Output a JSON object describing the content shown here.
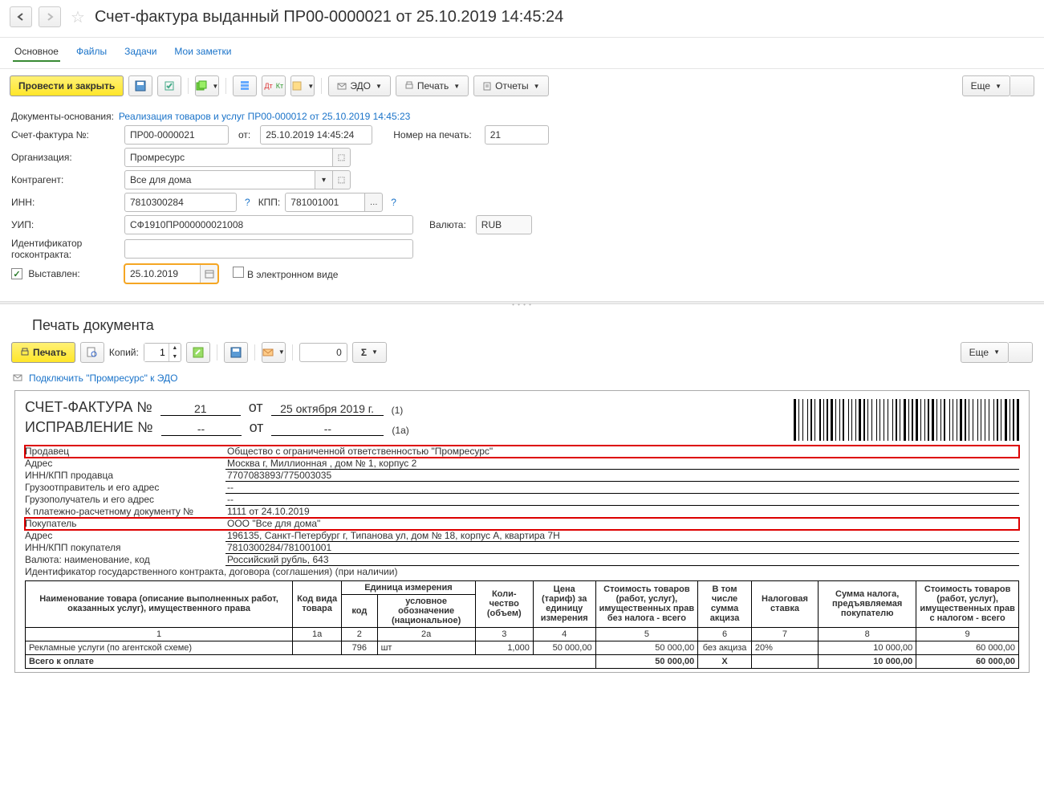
{
  "header": {
    "title": "Счет-фактура выданный ПР00-0000021 от 25.10.2019 14:45:24"
  },
  "tabs": {
    "main": "Основное",
    "files": "Файлы",
    "tasks": "Задачи",
    "notes": "Мои заметки"
  },
  "toolbar": {
    "post_close": "Провести и закрыть",
    "edo": "ЭДО",
    "print": "Печать",
    "reports": "Отчеты",
    "more": "Еще"
  },
  "basis": {
    "label": "Документы-основания:",
    "link": "Реализация товаров и услуг ПР00-000012 от 25.10.2019 14:45:23"
  },
  "form": {
    "invoice_no_label": "Счет-фактура №:",
    "invoice_no": "ПР00-0000021",
    "from_label": "от:",
    "from": "25.10.2019 14:45:24",
    "print_no_label": "Номер на печать:",
    "print_no": "21",
    "org_label": "Организация:",
    "org": "Промресурс",
    "counterparty_label": "Контрагент:",
    "counterparty": "Все для дома",
    "inn_label": "ИНН:",
    "inn": "7810300284",
    "kpp_label": "КПП:",
    "kpp": "781001001",
    "uip_label": "УИП:",
    "uip": "СФ1910ПР000000021008",
    "currency_label": "Валюта:",
    "currency": "RUB",
    "goscontract_label": "Идентификатор госконтракта:",
    "issued_label": "Выставлен:",
    "issued_date": "25.10.2019",
    "electronic": "В электронном виде"
  },
  "print_section": {
    "title": "Печать документа",
    "print_btn": "Печать",
    "copies_label": "Копий:",
    "copies": "1",
    "sum_input": "0",
    "more": "Еще",
    "edo_link": "Подключить \"Промресурс\" к ЭДО"
  },
  "doc": {
    "sf_label": "СЧЕТ-ФАКТУРА  №",
    "sf_no": "21",
    "sf_ot": "от",
    "date": "25 октября 2019 г.",
    "line1": "(1)",
    "corr_label": "ИСПРАВЛЕНИЕ №",
    "corr_no": "--",
    "corr_ot": "от",
    "corr_date": "--",
    "line1a": "(1а)",
    "rows": [
      {
        "k": "Продавец",
        "v": "Общество с ограниченной ответственностью \"Промресурс\"",
        "red": true
      },
      {
        "k": "Адрес",
        "v": "Москва г, Миллионная , дом № 1, корпус 2"
      },
      {
        "k": "ИНН/КПП продавца",
        "v": "7707083893/775003035"
      },
      {
        "k": "Грузоотправитель и его адрес",
        "v": "--"
      },
      {
        "k": "Грузополучатель и его адрес",
        "v": "--"
      },
      {
        "k": "К платежно-расчетному документу №",
        "v": "1111 от 24.10.2019"
      },
      {
        "k": "Покупатель",
        "v": "ООО \"Все для дома\"",
        "red": true
      },
      {
        "k": "Адрес",
        "v": "196135, Санкт-Петербург г, Типанова ул, дом № 18, корпус А, квартира 7Н"
      },
      {
        "k": "ИНН/КПП покупателя",
        "v": "7810300284/781001001"
      },
      {
        "k": "Валюта: наименование, код",
        "v": "Российский рубль, 643"
      }
    ],
    "goscontract_line": "Идентификатор государственного контракта, договора (соглашения) (при наличии)",
    "th": {
      "name": "Наименование товара (описание выполненных работ, оказанных услуг), имущественного права",
      "code": "Код вида товара",
      "unit": "Единица измерения",
      "unit_code": "код",
      "unit_name": "условное обозначение (национальное)",
      "qty": "Коли-\nчество (объем)",
      "price": "Цена (тариф) за единицу измерения",
      "cost_no_tax": "Стоимость товаров (работ, услуг), имущественных прав без налога - всего",
      "excise": "В том числе сумма акциза",
      "tax_rate": "Налоговая ставка",
      "tax_sum": "Сумма налога, предъявляемая покупателю",
      "cost_tax": "Стоимость товаров (работ, услуг), имущественных прав с налогом - всего"
    },
    "nums": [
      "1",
      "1а",
      "2",
      "2а",
      "3",
      "4",
      "5",
      "6",
      "7",
      "8",
      "9"
    ],
    "item": {
      "name": "Рекламные услуги (по агентской схеме)",
      "unit_code": "796",
      "unit_name": "шт",
      "qty": "1,000",
      "price": "50 000,00",
      "cost_no_tax": "50 000,00",
      "excise": "без акциза",
      "rate": "20%",
      "tax": "10 000,00",
      "total": "60 000,00"
    },
    "total": {
      "label": "Всего к оплате",
      "no_tax": "50 000,00",
      "x": "X",
      "tax": "10 000,00",
      "with_tax": "60 000,00"
    }
  }
}
